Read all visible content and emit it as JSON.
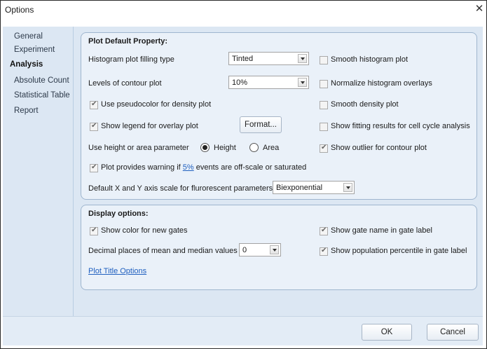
{
  "window": {
    "title": "Options",
    "close_glyph": "✕"
  },
  "sidebar": {
    "items": [
      {
        "label": "General",
        "active": false
      },
      {
        "label": "Experiment",
        "active": false
      },
      {
        "label": "Analysis",
        "active": true
      },
      {
        "label": "Absolute Count",
        "active": false
      },
      {
        "label": "Statistical Table",
        "active": false
      },
      {
        "label": "Report",
        "active": false
      }
    ]
  },
  "plot_default": {
    "title": "Plot Default Property:",
    "histogram_filling": {
      "label": "Histogram plot filling type",
      "value": "Tinted"
    },
    "contour_levels": {
      "label": "Levels of contour plot",
      "value": "10%"
    },
    "pseudocolor": {
      "label": "Use pseudocolor for density plot",
      "checked": true
    },
    "show_legend": {
      "label": "Show legend for overlay plot",
      "checked": true
    },
    "format_button": "Format...",
    "height_area": {
      "label": "Use height or area parameter",
      "option_height": "Height",
      "option_area": "Area",
      "selected": "Height"
    },
    "warning": {
      "prefix": "Plot provides warning if ",
      "link": "5%",
      "suffix": " events are off-scale or saturated",
      "checked": true
    },
    "axis_scale": {
      "label": "Default X and Y axis scale for flurorescent parameters",
      "value": "Biexponential"
    },
    "smooth_histogram": {
      "label": "Smooth histogram plot",
      "checked": false
    },
    "normalize_histogram": {
      "label": "Normalize histogram overlays",
      "checked": false
    },
    "smooth_density": {
      "label": "Smooth density  plot",
      "checked": false
    },
    "fitting_results": {
      "label": "Show fitting results for cell cycle analysis",
      "checked": false
    },
    "show_outlier": {
      "label": "Show outlier for contour plot",
      "checked": true
    }
  },
  "display_options": {
    "title": "Display options:",
    "show_color_gates": {
      "label": "Show color for new gates",
      "checked": true
    },
    "decimal_places": {
      "label": "Decimal places of mean and median values",
      "value": "0"
    },
    "plot_title_link": "Plot Title Options",
    "show_gate_name": {
      "label": "Show gate name in gate label",
      "checked": true
    },
    "show_population": {
      "label": "Show population percentile in gate label",
      "checked": true
    }
  },
  "footer": {
    "ok_label": "OK",
    "cancel_label": "Cancel"
  }
}
